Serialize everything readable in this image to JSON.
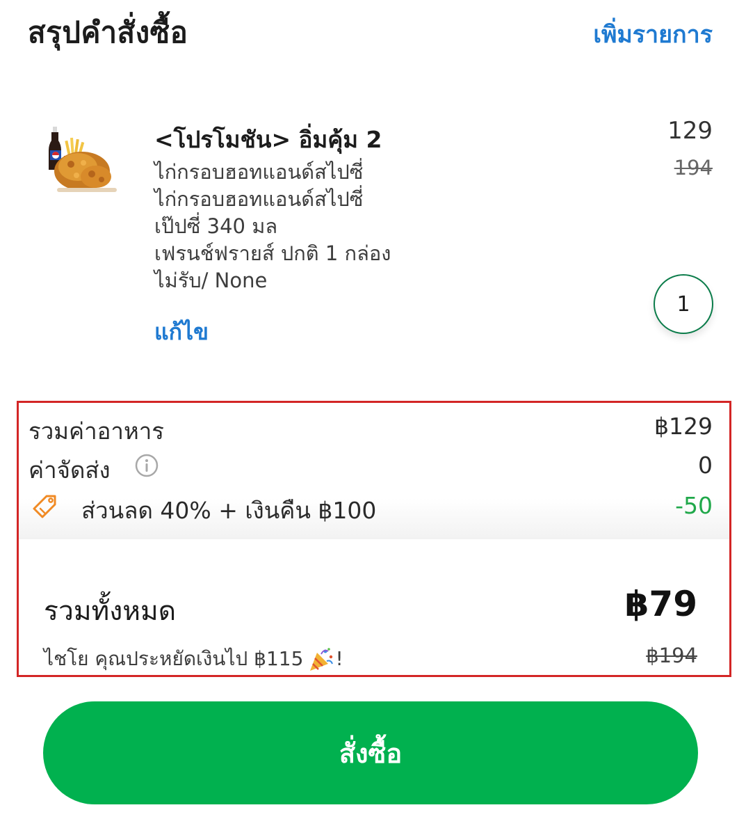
{
  "header": {
    "title": "สรุปคำสั่งซื้อ",
    "add_items_label": "เพิ่มรายการ"
  },
  "item": {
    "image_icon": "fried-chicken-combo-image",
    "name": "<โปรโมชัน> อิ่มคุ้ม 2",
    "options": [
      "ไก่กรอบฮอทแอนด์สไปซี่",
      "ไก่กรอบฮอทแอนด์สไปซี่",
      "เป๊ปซี่ 340 มล",
      "เฟรนช์ฟรายส์ ปกติ 1 กล่อง",
      "ไม่รับ/ None"
    ],
    "edit_label": "แก้ไข",
    "price": "129",
    "original_price": "194",
    "quantity": "1"
  },
  "summary": {
    "food_total_label": "รวมค่าอาหาร",
    "food_total_value": "฿129",
    "delivery_label": "ค่าจัดส่ง",
    "delivery_value": "0",
    "info_icon": "info-icon",
    "discount_icon": "tag-icon",
    "discount_label": "ส่วนลด 40% + เงินคืน ฿100",
    "discount_value": "-50",
    "grand_total_label": "รวมทั้งหมด",
    "grand_total_value": "฿79",
    "savings_text": "ไชโย คุณประหยัดเงินไป  ฿115",
    "savings_suffix": "!",
    "party_icon": "party-popper-icon",
    "original_total": "฿194"
  },
  "order_button": {
    "label": "สั่งซื้อ"
  },
  "colors": {
    "link_blue": "#1f7ad1",
    "order_green": "#01b14f",
    "discount_green": "#20a84a",
    "highlight_red": "#d32626",
    "tag_orange": "#f08a24"
  }
}
